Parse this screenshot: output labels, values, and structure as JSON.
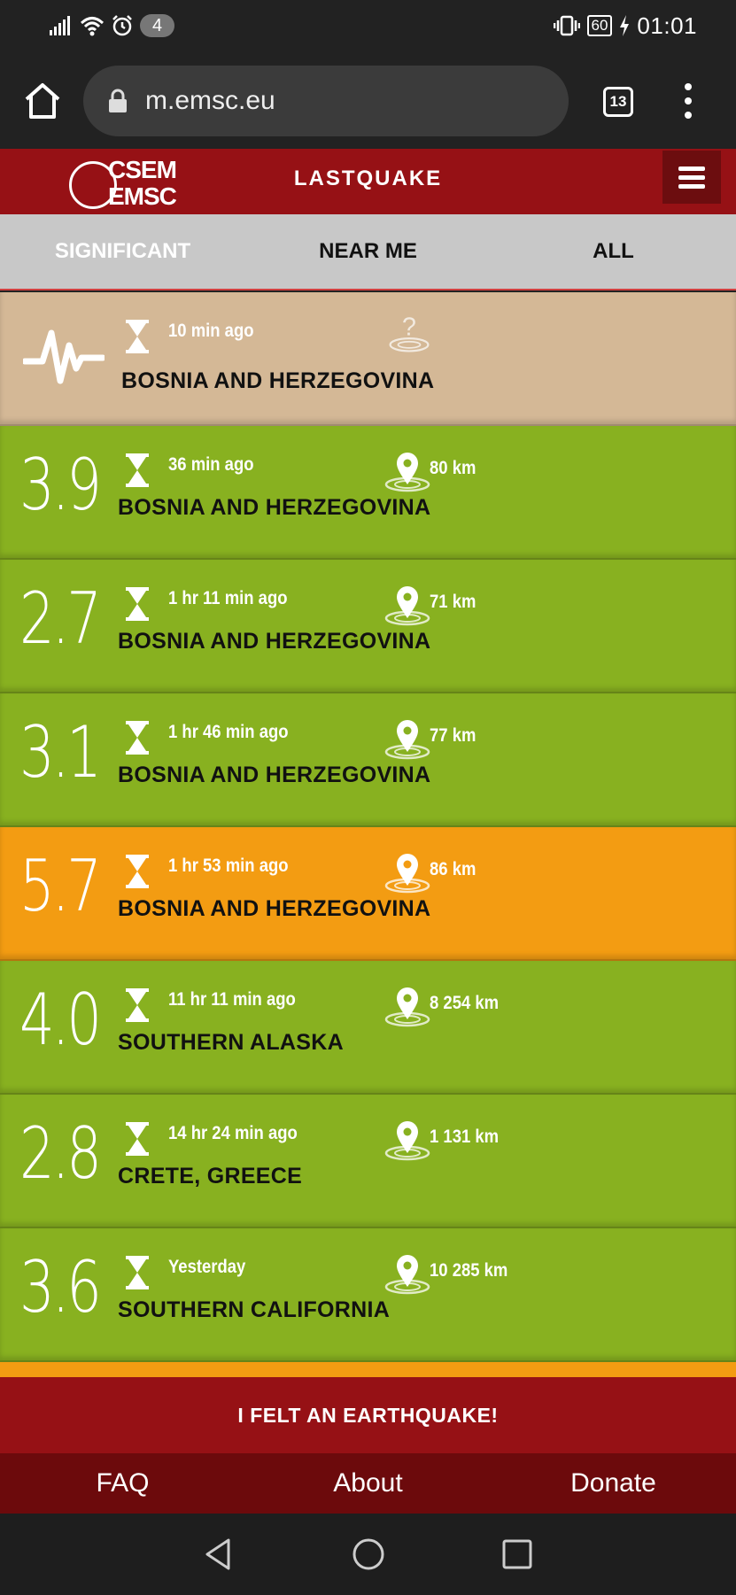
{
  "status_bar": {
    "notification_count": "4",
    "battery": "60",
    "time": "01:01"
  },
  "browser": {
    "url": "m.emsc.eu",
    "tab_count": "13"
  },
  "header": {
    "logo_line1": "CSEM",
    "logo_line2": "EMSC",
    "title": "LASTQUAKE"
  },
  "tabs": [
    {
      "label": "SIGNIFICANT",
      "active": true
    },
    {
      "label": "NEAR ME",
      "active": false
    },
    {
      "label": "ALL",
      "active": false
    }
  ],
  "colors": {
    "header_red": "#961115",
    "green": "#88b120",
    "orange": "#f39c12",
    "pending": "#d4b896"
  },
  "quakes": [
    {
      "magnitude": "",
      "time": "10 min ago",
      "distance": "",
      "region": "BOSNIA AND HERZEGOVINA",
      "level": "pending",
      "icon": "seismic-wave-icon",
      "location_icon": "unknown-location-icon"
    },
    {
      "magnitude": "3.9",
      "time": "36 min ago",
      "distance": "80 km",
      "region": "BOSNIA AND HERZEGOVINA",
      "level": "green"
    },
    {
      "magnitude": "2.7",
      "time": "1 hr  11 min ago",
      "distance": "71 km",
      "region": "BOSNIA AND HERZEGOVINA",
      "level": "green"
    },
    {
      "magnitude": "3.1",
      "time": "1 hr  46 min ago",
      "distance": "77 km",
      "region": "BOSNIA AND HERZEGOVINA",
      "level": "green"
    },
    {
      "magnitude": "5.7",
      "time": "1 hr  53 min ago",
      "distance": "86 km",
      "region": "BOSNIA AND HERZEGOVINA",
      "level": "orange"
    },
    {
      "magnitude": "4.0",
      "time": "11 hr  11 min ago",
      "distance": "8 254 km",
      "region": "SOUTHERN ALASKA",
      "level": "green"
    },
    {
      "magnitude": "2.8",
      "time": "14 hr  24 min ago",
      "distance": "1 131 km",
      "region": "CRETE, GREECE",
      "level": "green"
    },
    {
      "magnitude": "3.6",
      "time": "Yesterday",
      "distance": "10 285 km",
      "region": "SOUTHERN CALIFORNIA",
      "level": "green"
    }
  ],
  "felt_button": "I FELT AN EARTHQUAKE!",
  "footer": {
    "faq": "FAQ",
    "about": "About",
    "donate": "Donate"
  }
}
